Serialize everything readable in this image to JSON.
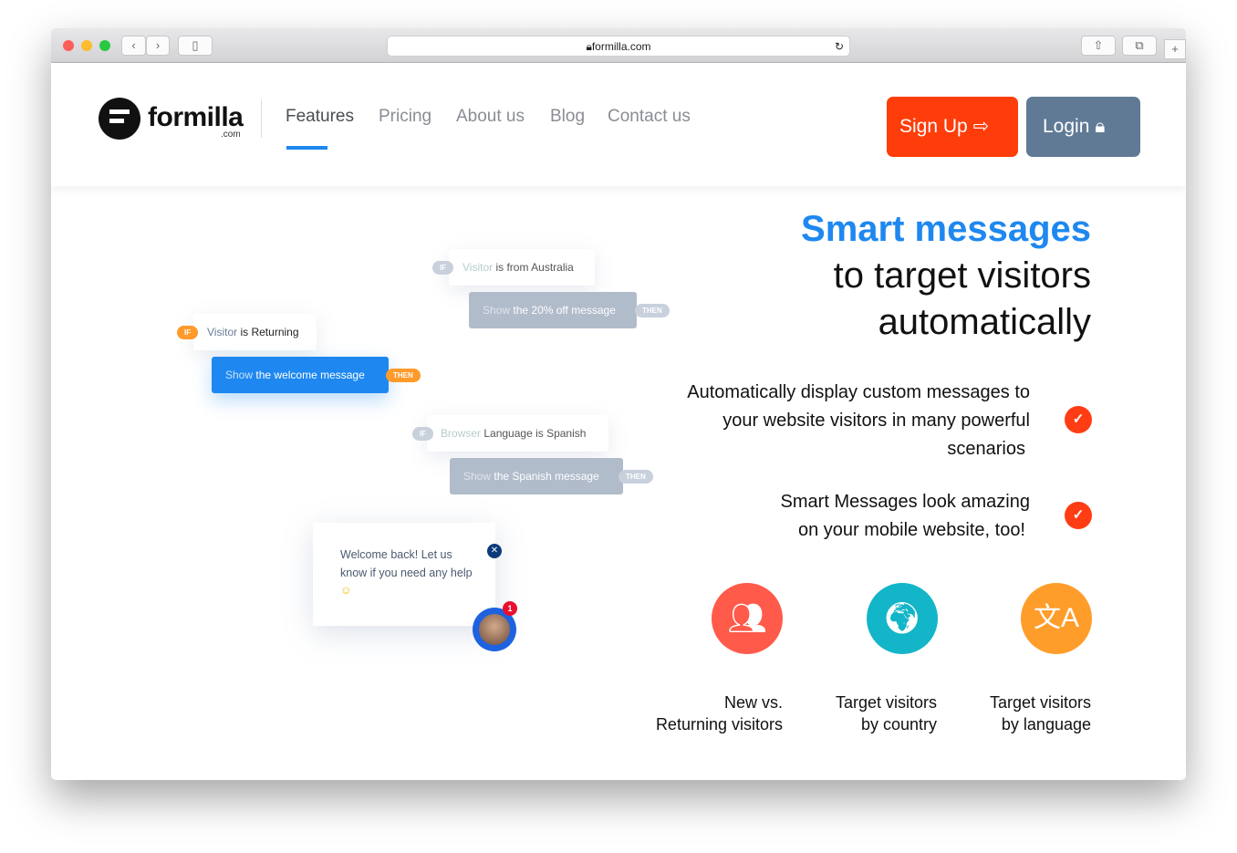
{
  "browser": {
    "url": "formilla.com"
  },
  "header": {
    "logo": "formilla",
    "logo_sub": ".com",
    "nav": [
      {
        "label": "Features"
      },
      {
        "label": "Pricing"
      },
      {
        "label": "About us"
      },
      {
        "label": "Blog"
      },
      {
        "label": "Contact us"
      }
    ],
    "signup": "Sign Up",
    "login": "Login"
  },
  "rules": [
    {
      "if": "IF",
      "subject": "Visitor",
      "condition": "is Returning",
      "action_light": "Show",
      "action": "the welcome message",
      "then": "THEN"
    },
    {
      "if": "IF",
      "subject": "Visitor",
      "condition": "is from Australia",
      "action_light": "Show",
      "action": "the 20% off message",
      "then": "THEN"
    },
    {
      "if": "IF",
      "subject": "Browser",
      "condition": "Language is Spanish",
      "action_light": "Show",
      "action": "the Spanish message",
      "then": "THEN"
    }
  ],
  "chat": {
    "message": "Welcome back! Let us know if you need any help",
    "badge": "1"
  },
  "hero": {
    "title_accent": "Smart messages",
    "title_line2": "to target visitors",
    "title_line3": "automatically"
  },
  "points": [
    {
      "line1": "Automatically display custom messages to",
      "line2": "your website visitors in many powerful",
      "line3": "scenarios"
    },
    {
      "line1": "Smart Messages look amazing",
      "line2": "on your mobile website, too!"
    }
  ],
  "features": [
    {
      "line1": "New vs.",
      "line2": "Returning visitors",
      "icon": "users-icon",
      "color": "#ff5a4a"
    },
    {
      "line1": "Target visitors",
      "line2": "by country",
      "icon": "globe-icon",
      "color": "#13b5c8"
    },
    {
      "line1": "Target visitors",
      "line2": "by language",
      "icon": "translate-icon",
      "color": "#ff9d2a"
    }
  ],
  "colors": {
    "accent": "#1e88f0",
    "signup": "#ff3d0a",
    "login": "#607a96",
    "orange": "#ff9a2b"
  }
}
